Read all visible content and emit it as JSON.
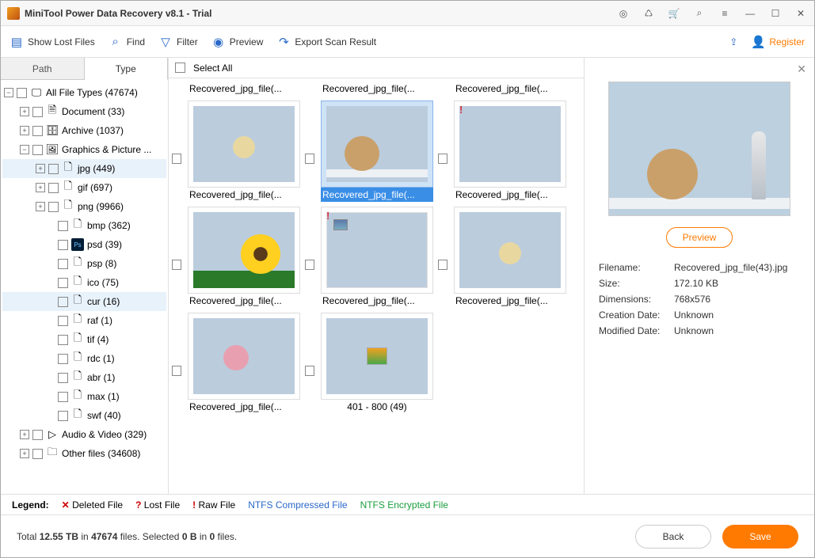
{
  "app": {
    "title": "MiniTool Power Data Recovery v8.1 - Trial"
  },
  "toolbar": {
    "show_lost": "Show Lost Files",
    "find": "Find",
    "filter": "Filter",
    "preview": "Preview",
    "export": "Export Scan Result",
    "register": "Register"
  },
  "tabs": {
    "path": "Path",
    "type": "Type"
  },
  "tree": {
    "root": "All File Types (47674)",
    "document": "Document (33)",
    "archive": "Archive (1037)",
    "graphics": "Graphics & Picture ...",
    "jpg": "jpg (449)",
    "gif": "gif (697)",
    "png": "png (9966)",
    "bmp": "bmp (362)",
    "psd": "psd (39)",
    "psp": "psp (8)",
    "ico": "ico (75)",
    "cur": "cur (16)",
    "raf": "raf (1)",
    "tif": "tif (4)",
    "rdc": "rdc (1)",
    "abr": "abr (1)",
    "max": "max (1)",
    "swf": "swf (40)",
    "audio": "Audio & Video (329)",
    "other": "Other files (34608)"
  },
  "selectall": "Select All",
  "thumbs": {
    "name_top": "Recovered_jpg_file(...",
    "name_sel": "Recovered_jpg_file(...",
    "range": "401 - 800 (49)"
  },
  "preview": {
    "btn": "Preview",
    "labels": {
      "filename": "Filename:",
      "size": "Size:",
      "dim": "Dimensions:",
      "created": "Creation Date:",
      "modified": "Modified Date:"
    },
    "values": {
      "filename": "Recovered_jpg_file(43).jpg",
      "size": "172.10 KB",
      "dim": "768x576",
      "created": "Unknown",
      "modified": "Unknown"
    }
  },
  "legend": {
    "label": "Legend:",
    "deleted": "Deleted File",
    "lost": "Lost File",
    "raw": "Raw File",
    "compressed": "NTFS Compressed File",
    "encrypted": "NTFS Encrypted File"
  },
  "footer": {
    "status_a": "Total ",
    "status_b": "12.55 TB",
    "status_c": " in ",
    "status_d": "47674",
    "status_e": " files.   Selected ",
    "status_f": "0 B",
    "status_g": " in ",
    "status_h": "0",
    "status_i": " files.",
    "back": "Back",
    "save": "Save"
  }
}
